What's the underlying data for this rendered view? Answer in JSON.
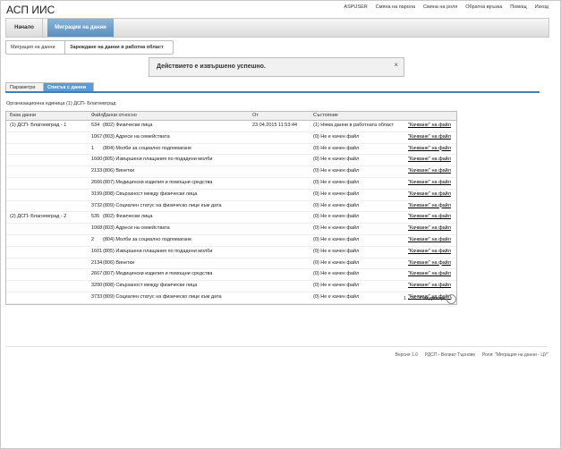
{
  "app": {
    "title": "АСП ИИС"
  },
  "top_links": [
    "ASPUSER",
    "Смяна на парола",
    "Смяна на роля",
    "Обратна връзка",
    "Помощ",
    "Изход"
  ],
  "nav": {
    "home": "Начало",
    "migration": "Миграции на данни"
  },
  "breadcrumb": [
    "Миграция на данни",
    "Зареждане на данни в работна област"
  ],
  "alert": {
    "text": "Действието е извършено успешно.",
    "close": "×"
  },
  "tabs": {
    "params": "Параметри",
    "list": "Списък с данни"
  },
  "org_unit": "Организационна единица (1) ДСП- Благоевград",
  "table": {
    "headers": {
      "base": "База данни",
      "file": "Файл",
      "data": "Данни относно",
      "from": "От",
      "state": "Състояние"
    },
    "rows": [
      {
        "base": "(1) ДСП- Благоевград - 1",
        "file": "534",
        "data": "(802) Физически лица",
        "from": "23.04.2015 11:53:44",
        "state": "(1) Няма данни в работната област",
        "link": "\"Качване\" на файл"
      },
      {
        "base": "",
        "file": "1067",
        "data": "(803) Адреси на семействата",
        "from": "",
        "state": "(0) Не е качен файл",
        "link": "\"Качване\" на файл"
      },
      {
        "base": "",
        "file": "1",
        "data": "(804) Молби за социално подпомагане",
        "from": "",
        "state": "(0) Не е качен файл",
        "link": "\"Качване\" на файл"
      },
      {
        "base": "",
        "file": "1600",
        "data": "(805) Извършени плащания по подадени молби",
        "from": "",
        "state": "(0) Не е качен файл",
        "link": "\"Качване\" на файл"
      },
      {
        "base": "",
        "file": "2133",
        "data": "(806) Винетки",
        "from": "",
        "state": "(0) Не е качен файл",
        "link": "\"Качване\" на файл"
      },
      {
        "base": "",
        "file": "2666",
        "data": "(807) Медицински изделия и помощни средства",
        "from": "",
        "state": "(0) Не е качен файл",
        "link": "\"Качване\" на файл"
      },
      {
        "base": "",
        "file": "3199",
        "data": "(808) Свързаност между физически лица",
        "from": "",
        "state": "(0) Не е качен файл",
        "link": "\"Качване\" на файл"
      },
      {
        "base": "",
        "file": "3732",
        "data": "(809) Социален статус на физическо лице към дата",
        "from": "",
        "state": "(0) Не е качен файл",
        "link": "\"Качване\" на файл"
      },
      {
        "base": "(2) ДСП- Благоевград - 2",
        "file": "535",
        "data": "(802) Физически лица",
        "from": "",
        "state": "(0) Не е качен файл",
        "link": "\"Качване\" на файл"
      },
      {
        "base": "",
        "file": "1068",
        "data": "(803) Адреси на семействата",
        "from": "",
        "state": "(0) Не е качен файл",
        "link": "\"Качване\" на файл"
      },
      {
        "base": "",
        "file": "2",
        "data": "(804) Молби за социално подпомагане",
        "from": "",
        "state": "(0) Не е качен файл",
        "link": "\"Качване\" на файл"
      },
      {
        "base": "",
        "file": "1601",
        "data": "(805) Извършени плащания по подадени молби",
        "from": "",
        "state": "(0) Не е качен файл",
        "link": "\"Качване\" на файл"
      },
      {
        "base": "",
        "file": "2134",
        "data": "(806) Винетки",
        "from": "",
        "state": "(0) Не е качен файл",
        "link": "\"Качване\" на файл"
      },
      {
        "base": "",
        "file": "2667",
        "data": "(807) Медицински изделия и помощни средства",
        "from": "",
        "state": "(0) Не е качен файл",
        "link": "\"Качване\" на файл"
      },
      {
        "base": "",
        "file": "3200",
        "data": "(808) Свързаност между физически лица",
        "from": "",
        "state": "(0) Не е качен файл",
        "link": "\"Качване\" на файл"
      },
      {
        "base": "",
        "file": "3733",
        "data": "(809) Социален статус на физическо лице към дата",
        "from": "",
        "state": "(0) Не е качен файл",
        "link": "\"Качване\" на файл"
      }
    ]
  },
  "pager": {
    "range": "1 - 16",
    "next": "Следващи",
    "arrow": "›"
  },
  "footer": [
    "Версия 1.0",
    "РДСП - Велико Търново",
    "Роля: \"Миграция на данни - ЦУ\""
  ]
}
